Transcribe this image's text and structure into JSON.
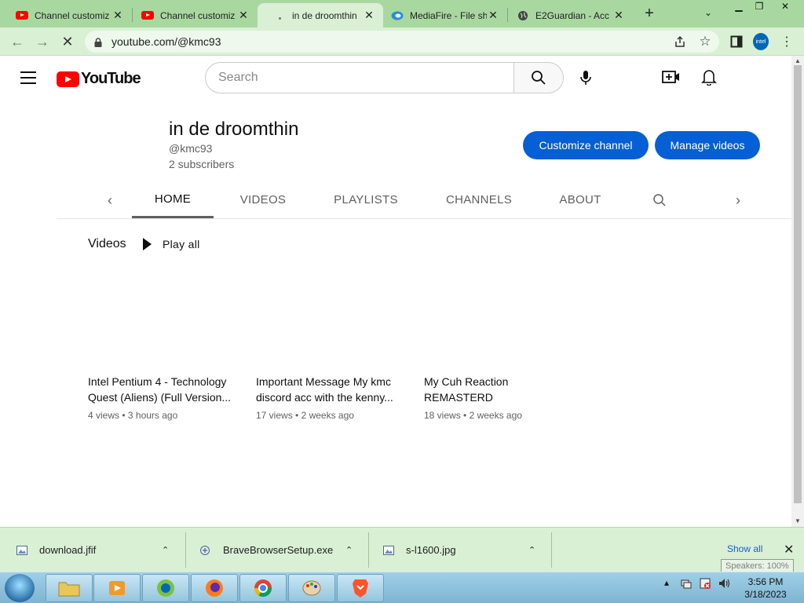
{
  "browser": {
    "tabs": [
      {
        "title": "Channel customiz",
        "favicon": "youtube-icon",
        "active": false
      },
      {
        "title": "Channel customiz",
        "favicon": "youtube-icon",
        "active": false
      },
      {
        "title": "in de droomthin",
        "favicon": "loading-icon",
        "active": true
      },
      {
        "title": "MediaFire - File sh",
        "favicon": "mediafire-icon",
        "active": false
      },
      {
        "title": "E2Guardian - Acc",
        "favicon": "globe-icon",
        "active": false
      }
    ],
    "new_tab": "+",
    "url": "youtube.com/@kmc93",
    "profile_label": "intel"
  },
  "youtube": {
    "logo_text": "YouTube",
    "search_placeholder": "Search",
    "channel": {
      "name": "in de droomthin",
      "handle": "@kmc93",
      "subscribers": "2 subscribers"
    },
    "buttons": {
      "customize": "Customize channel",
      "manage": "Manage videos"
    },
    "tabs": [
      "HOME",
      "VIDEOS",
      "PLAYLISTS",
      "CHANNELS",
      "ABOUT"
    ],
    "active_tab": "HOME",
    "section": {
      "title": "Videos",
      "play_all": "Play all"
    },
    "videos": [
      {
        "title": "Intel Pentium 4 - Technology Quest (Aliens) (Full Version...",
        "views": "4 views",
        "age": "3 hours ago"
      },
      {
        "title": "Important Message My kmc discord acc with the kenny...",
        "views": "17 views",
        "age": "2 weeks ago"
      },
      {
        "title": "My Cuh Reaction REMASTERD",
        "views": "18 views",
        "age": "2 weeks ago"
      }
    ]
  },
  "downloads": {
    "items": [
      "download.jfif",
      "BraveBrowserSetup.exe",
      "s-l1600.jpg"
    ],
    "show_all": "Show all"
  },
  "tooltip": "Speakers: 100%",
  "taskbar": {
    "time": "3:56 PM",
    "date": "3/18/2023"
  },
  "colors": {
    "accent": "#065fd4",
    "youtube_red": "#ff0000",
    "browser_frame": "#a8d8a0"
  }
}
